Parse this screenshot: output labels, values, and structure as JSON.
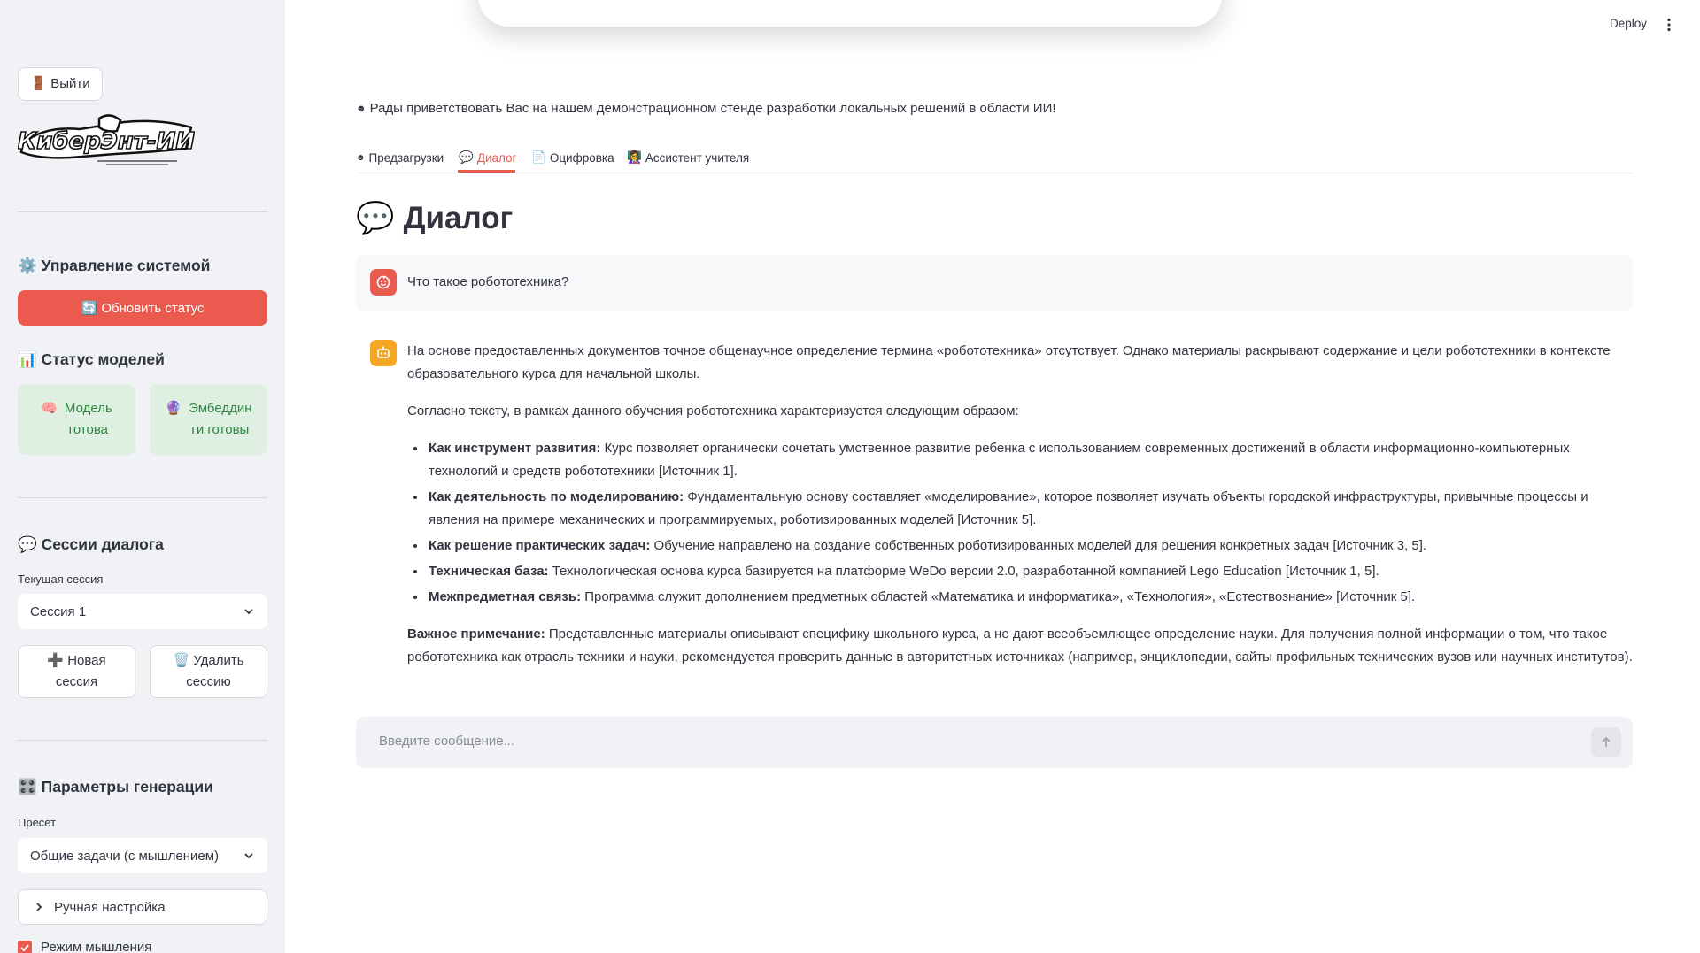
{
  "header": {
    "deploy_label": "Deploy"
  },
  "sidebar": {
    "logout_label": "🚪 Выйти",
    "logo_text": "КиберЭнт-ИИ",
    "system": {
      "title": "⚙️ Управление системой",
      "refresh_label": "🔄 Обновить статус"
    },
    "models": {
      "title": "📊 Статус моделей",
      "model_icon": "🧠",
      "model_line1": "Модель",
      "model_line2": "готова",
      "emb_icon": "🔮",
      "emb_line1": "Эмбеддин",
      "emb_line2": "ги готовы"
    },
    "sessions": {
      "title": "💬 Сессии диалога",
      "current_label": "Текущая сессия",
      "current_value": "Сессия 1",
      "new_line1": "➕ Новая",
      "new_line2": "сессия",
      "delete_line1": "🗑️ Удалить",
      "delete_line2": "сессию"
    },
    "generation": {
      "title": "🎛️ Параметры генерации",
      "preset_label": "Пресет",
      "preset_value": "Общие задачи (с мышлением)",
      "manual_label": "Ручная настройка",
      "thinking_label": "Режим мышления"
    }
  },
  "main": {
    "welcome": "Рады приветствовать Вас на нашем демонстрационном стенде разработки локальных решений в области ИИ!",
    "tabs": [
      {
        "icon": "☻",
        "label": "Предзагрузки"
      },
      {
        "icon": "💬",
        "label": "Диалог"
      },
      {
        "icon": "📄",
        "label": "Оцифровка"
      },
      {
        "icon": "👩‍🏫",
        "label": "Ассистент учителя"
      }
    ],
    "title_icon": "💬",
    "title": "Диалог",
    "user_message": "Что такое робототехника?",
    "answer": {
      "p1": "На основе предоставленных документов точное общенаучное определение термина «робототехника» отсутствует. Однако материалы раскрывают содержание и цели робототехники в контексте образовательного курса для начальной школы.",
      "p2": "Согласно тексту, в рамках данного обучения робототехника характеризуется следующим образом:",
      "bullets": [
        {
          "bold": "Как инструмент развития:",
          "text": " Курс позволяет органически сочетать умственное развитие ребенка с использованием современных достижений в области информационно-компьютерных технологий и средств робототехники [Источник 1]."
        },
        {
          "bold": "Как деятельность по моделированию:",
          "text": " Фундаментальную основу составляет «моделирование», которое позволяет изучать объекты городской инфраструктуры, привычные процессы и явления на примере механических и программируемых, роботизированных моделей [Источник 5]."
        },
        {
          "bold": "Как решение практических задач:",
          "text": " Обучение направлено на создание собственных роботизированных моделей для решения конкретных задач [Источник 3, 5]."
        },
        {
          "bold": "Техническая база:",
          "text": " Технологическая основа курса базируется на платформе WeDo версии 2.0, разработанной компанией Lego Education [Источник 1, 5]."
        },
        {
          "bold": "Межпредметная связь:",
          "text": " Программа служит дополнением предметных областей «Математика и информатика», «Технология», «Естествознание» [Источник 5]."
        }
      ],
      "note_bold": "Важное примечание:",
      "note_text": " Представленные материалы описывают специфику школьного курса, а не дают всеобъемлющее определение науки. Для получения полной информации о том, что такое робототехника как отрасль техники и науки, рекомендуется проверить данные в авторитетных источниках (например, энциклопедии, сайты профильных технических вузов или научных институтов)."
    },
    "input_placeholder": "Введите сообщение..."
  },
  "colors": {
    "accent": "#ea5a4f",
    "sidebar_bg": "#f0f2f6",
    "success_bg": "#dff0e2",
    "success_text": "#2e8540",
    "bot_avatar": "#f5a623"
  }
}
